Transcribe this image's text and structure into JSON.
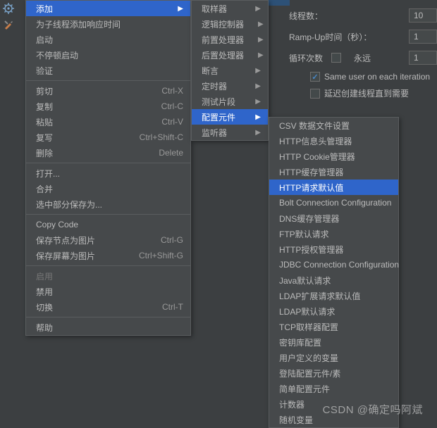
{
  "toolbar": {
    "gear_icon": "gear-icon",
    "tools_icon": "tools-icon"
  },
  "rightPanel": {
    "threads_label": "线程数：",
    "threads_value": "10",
    "rampup_label": "Ramp-Up时间（秒）：",
    "rampup_value": "1",
    "loop_label": "循环次数",
    "forever_label": "永远",
    "loop_value": "1",
    "same_user_label": "Same user on each iteration",
    "delay_create_label": "延迟创建线程直到需要"
  },
  "menu1": {
    "items": [
      {
        "label": "添加",
        "arrow": true,
        "hi": true
      },
      {
        "label": "为子线程添加响应时间"
      },
      {
        "label": "启动"
      },
      {
        "label": "不停顿启动"
      },
      {
        "label": "验证"
      },
      {
        "sep": true
      },
      {
        "label": "剪切",
        "shortcut": "Ctrl-X"
      },
      {
        "label": "复制",
        "shortcut": "Ctrl-C"
      },
      {
        "label": "粘贴",
        "shortcut": "Ctrl-V"
      },
      {
        "label": "复写",
        "shortcut": "Ctrl+Shift-C"
      },
      {
        "label": "删除",
        "shortcut": "Delete"
      },
      {
        "sep": true
      },
      {
        "label": "打开..."
      },
      {
        "label": "合并"
      },
      {
        "label": "选中部分保存为..."
      },
      {
        "sep": true
      },
      {
        "label": "Copy Code"
      },
      {
        "label": "保存节点为图片",
        "shortcut": "Ctrl-G"
      },
      {
        "label": "保存屏幕为图片",
        "shortcut": "Ctrl+Shift-G"
      },
      {
        "sep": true
      },
      {
        "label": "启用",
        "disabled": true
      },
      {
        "label": "禁用"
      },
      {
        "label": "切换",
        "shortcut": "Ctrl-T"
      },
      {
        "sep": true
      },
      {
        "label": "帮助"
      }
    ]
  },
  "menu2": {
    "items": [
      {
        "label": "取样器",
        "arrow": true
      },
      {
        "label": "逻辑控制器",
        "arrow": true
      },
      {
        "label": "前置处理器",
        "arrow": true
      },
      {
        "label": "后置处理器",
        "arrow": true
      },
      {
        "label": "断言",
        "arrow": true
      },
      {
        "label": "定时器",
        "arrow": true
      },
      {
        "label": "测试片段",
        "arrow": true
      },
      {
        "label": "配置元件",
        "arrow": true,
        "hi": true
      },
      {
        "label": "监听器",
        "arrow": true
      }
    ]
  },
  "menu3": {
    "items": [
      {
        "label": "CSV 数据文件设置"
      },
      {
        "label": "HTTP信息头管理器"
      },
      {
        "label": "HTTP Cookie管理器"
      },
      {
        "label": "HTTP缓存管理器"
      },
      {
        "label": "HTTP请求默认值",
        "hi": true
      },
      {
        "label": "Bolt Connection Configuration"
      },
      {
        "label": "DNS缓存管理器"
      },
      {
        "label": "FTP默认请求"
      },
      {
        "label": "HTTP授权管理器"
      },
      {
        "label": "JDBC Connection Configuration"
      },
      {
        "label": "Java默认请求"
      },
      {
        "label": "LDAP扩展请求默认值"
      },
      {
        "label": "LDAP默认请求"
      },
      {
        "label": "TCP取样器配置"
      },
      {
        "label": "密钥库配置"
      },
      {
        "label": "用户定义的变量"
      },
      {
        "label": "登陆配置元件/素"
      },
      {
        "label": "简单配置元件"
      },
      {
        "label": "计数器"
      },
      {
        "label": "随机变量"
      }
    ]
  },
  "watermark": "CSDN @确定吗阿斌"
}
